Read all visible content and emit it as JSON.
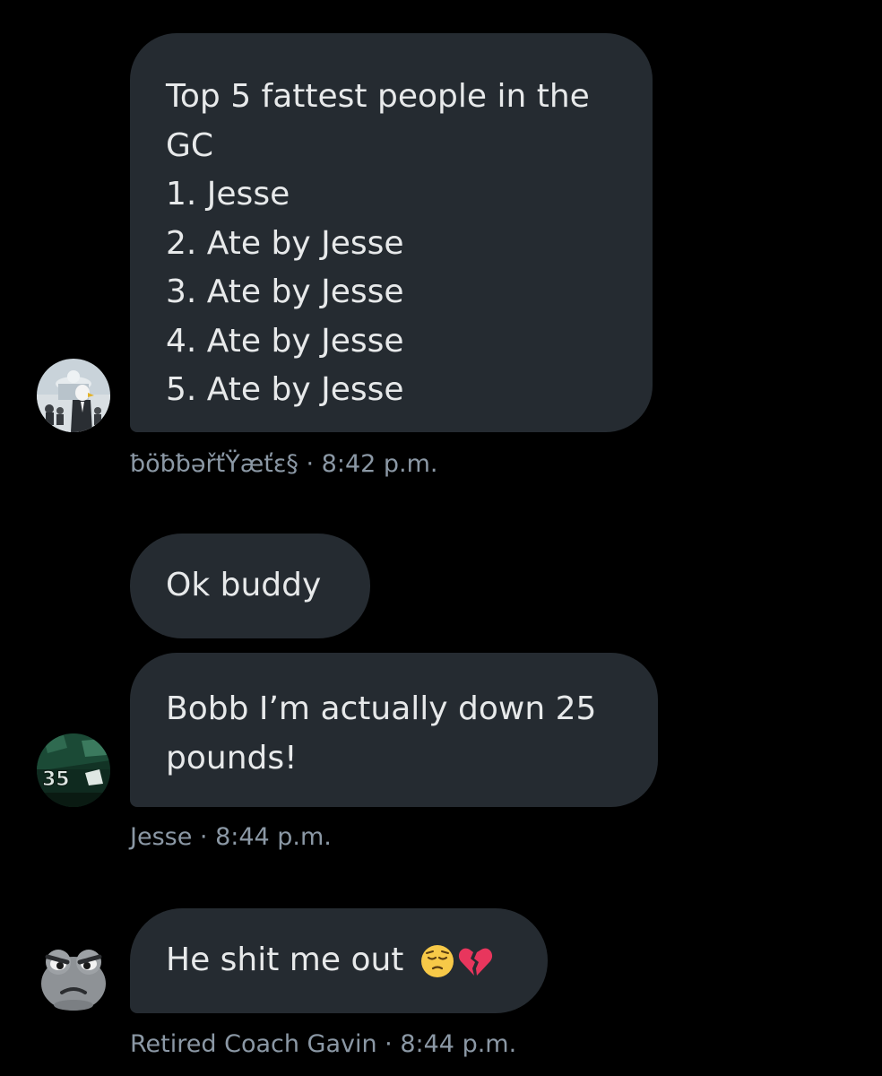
{
  "messages": [
    {
      "lines": [
        "Top 5 fattest people in the",
        "GC",
        "1. Jesse",
        "2. Ate by Jesse",
        "3. Ate by Jesse",
        "4. Ate by Jesse",
        "5. Ate by Jesse"
      ],
      "meta": "ƀöƀƀəřťŸæťɛ§ · 8:42 p.m."
    },
    {
      "lines": [
        "Ok buddy"
      ]
    },
    {
      "lines": [
        "Bobb I’m actually down 25",
        "pounds!"
      ],
      "meta": "Jesse · 8:44 p.m."
    },
    {
      "lines": [
        "He shit me out"
      ],
      "emojis": [
        "pensive-face-emoji",
        "broken-heart-emoji"
      ],
      "meta": "Retired Coach Gavin · 8:44 p.m."
    }
  ],
  "avatars": [
    "eagle-in-suit-avatar",
    "jersey-35-avatar",
    "angry-frog-avatar"
  ],
  "colors": {
    "background": "#000000",
    "bubble": "#252b31",
    "text": "#e7e9ea",
    "meta": "#8b98a5"
  }
}
